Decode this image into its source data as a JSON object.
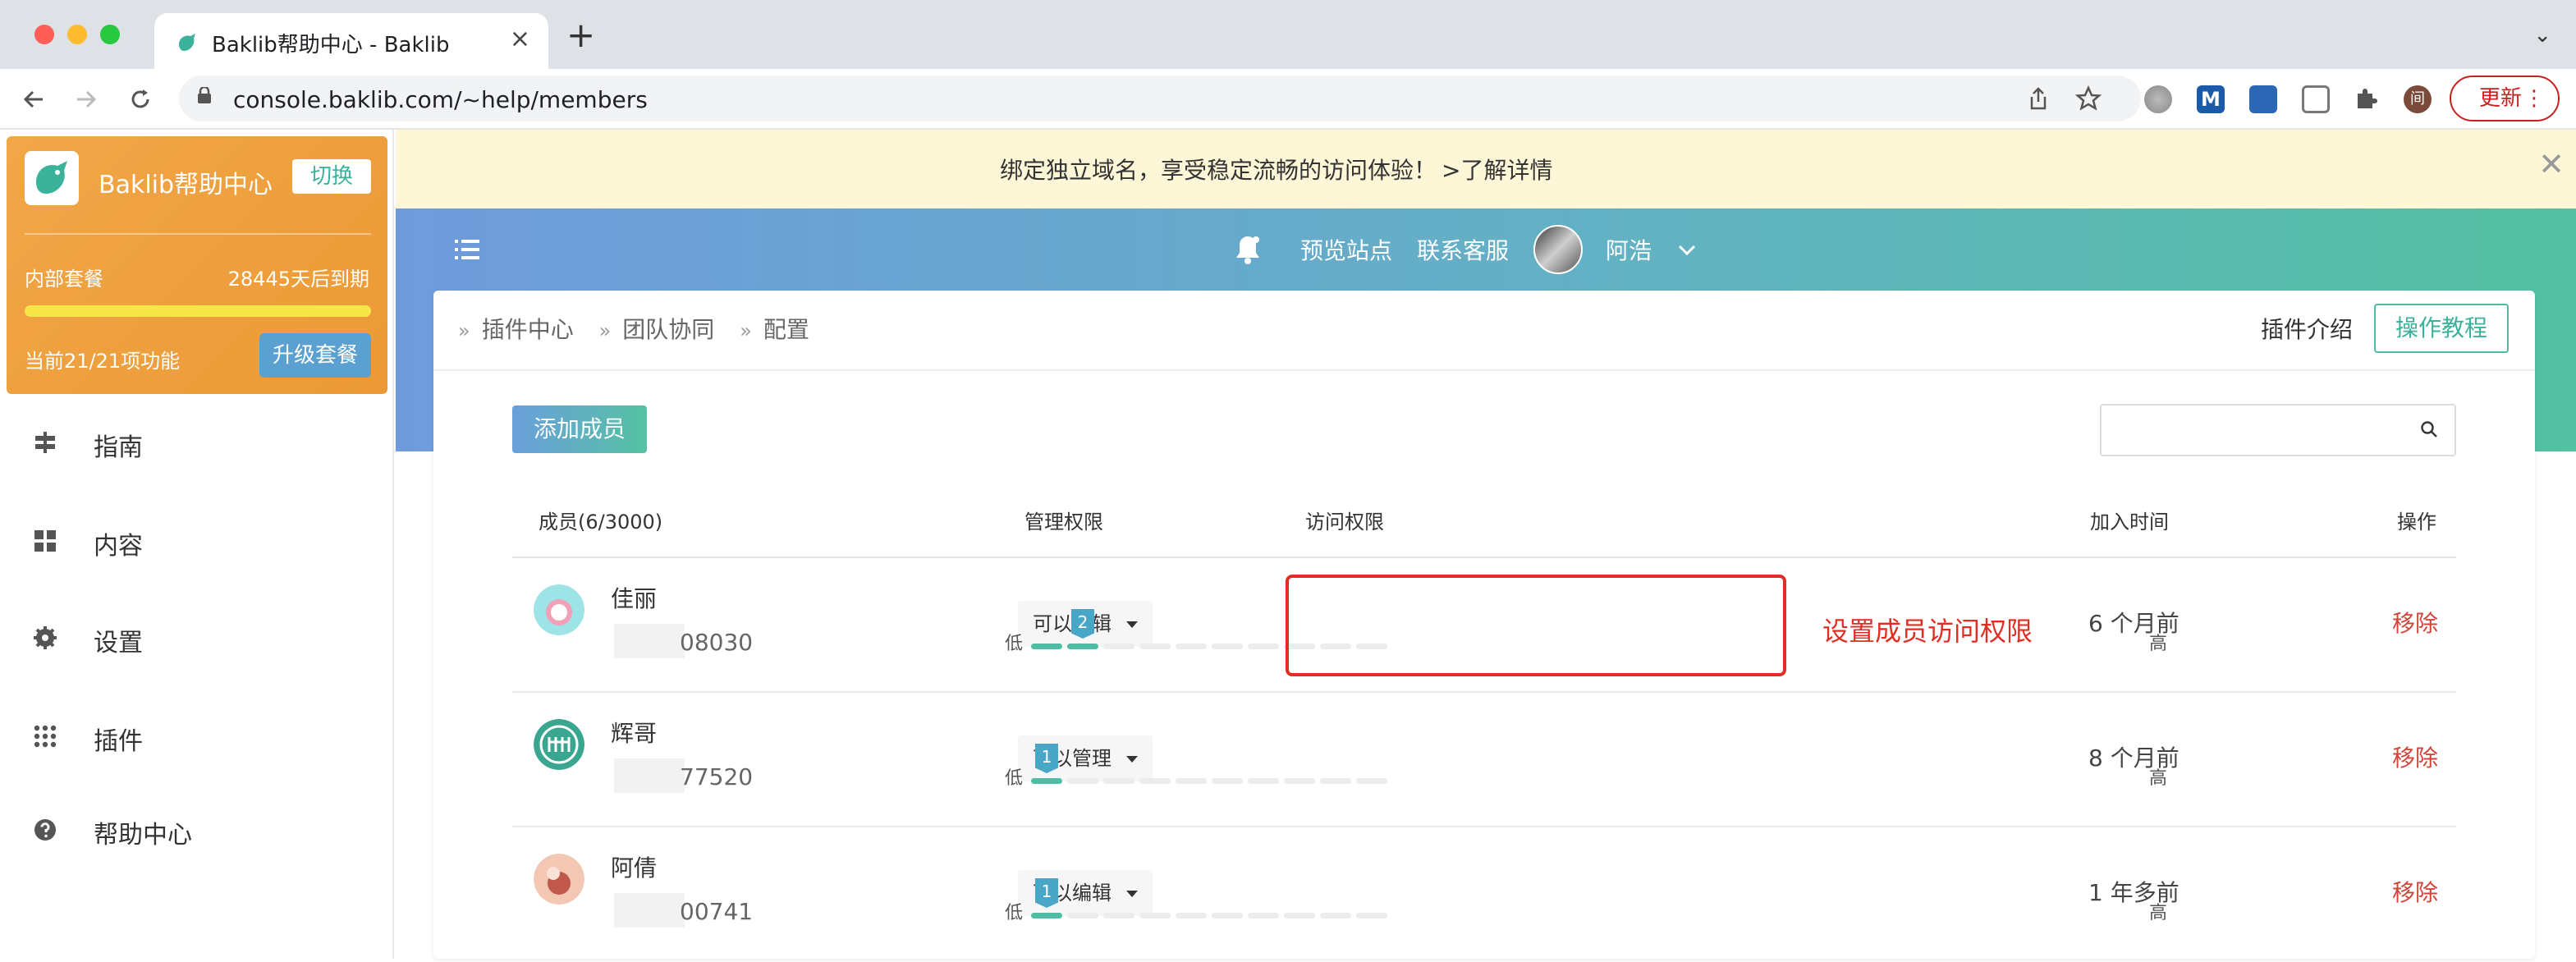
{
  "browser": {
    "tab_title": "Baklib帮助中心 - Baklib",
    "url": "console.baklib.com/~help/members",
    "update_label": "更新",
    "colors": {
      "red": "#ff5f57",
      "yellow": "#febc2e",
      "green": "#28c840"
    }
  },
  "sidebar": {
    "brand_name": "Baklib帮助中心",
    "switch_label": "切换",
    "plan_name": "内部套餐",
    "expire_text": "28445天后到期",
    "plan_progress_percent": 100,
    "features_text": "当前21/21项功能",
    "upgrade_label": "升级套餐",
    "items": [
      {
        "label": "指南",
        "icon": "signpost-icon"
      },
      {
        "label": "内容",
        "icon": "grid-icon"
      },
      {
        "label": "设置",
        "icon": "gear-icon"
      },
      {
        "label": "插件",
        "icon": "dots-grid-icon"
      },
      {
        "label": "帮助中心",
        "icon": "question-circle-icon"
      }
    ]
  },
  "banner": {
    "text": "绑定独立域名，享受稳定流畅的访问体验！",
    "link": ">了解详情"
  },
  "header": {
    "preview_site": "预览站点",
    "contact_support": "联系客服",
    "user_name": "阿浩"
  },
  "breadcrumb": [
    "插件中心",
    "团队协同",
    "配置"
  ],
  "actions": {
    "plugin_intro": "插件介绍",
    "tutorial": "操作教程",
    "add_member": "添加成员",
    "search_placeholder": ""
  },
  "table": {
    "headers": {
      "member": "成员(6/3000)",
      "manage": "管理权限",
      "access": "访问权限",
      "joined": "加入时间",
      "ops": "操作"
    },
    "low_label": "低",
    "high_label": "高",
    "levels_total": 10,
    "remove_label": "移除",
    "rows": [
      {
        "name": "佳丽",
        "id_suffix": "08030",
        "permission": "可以编辑",
        "access_level": 2,
        "joined": "6 个月前",
        "avatar_colors": [
          "#9ee3e6",
          "#f2a0b8"
        ]
      },
      {
        "name": "辉哥",
        "id_suffix": "77520",
        "permission": "可以管理",
        "access_level": 1,
        "joined": "8 个月前",
        "avatar_colors": [
          "#3aa690",
          "#ffffff"
        ]
      },
      {
        "name": "阿倩",
        "id_suffix": "00741",
        "permission": "可以编辑",
        "access_level": 1,
        "joined": "1 年多前",
        "avatar_colors": [
          "#f2c7b4",
          "#c0584b"
        ]
      }
    ]
  },
  "annotation": {
    "text": "设置成员访问权限",
    "color": "#e02e24"
  },
  "theme": {
    "accent": "#3bb39b",
    "danger": "#d0443a",
    "orange": "#f2a648"
  }
}
